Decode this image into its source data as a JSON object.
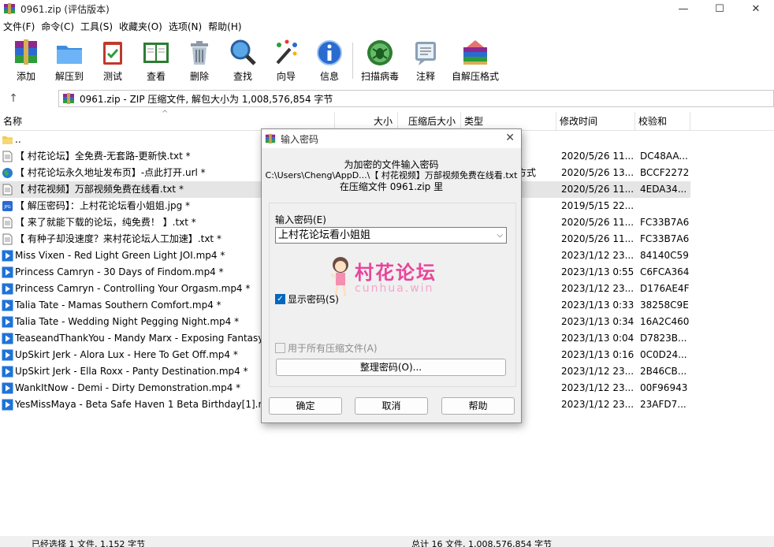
{
  "window": {
    "title": "0961.zip (评估版本)",
    "controls": [
      "—",
      "☐",
      "✕"
    ]
  },
  "menu": [
    "文件(F)",
    "命令(C)",
    "工具(S)",
    "收藏夹(O)",
    "选项(N)",
    "帮助(H)"
  ],
  "toolbar": {
    "add": "添加",
    "extract": "解压到",
    "test": "测试",
    "view": "查看",
    "delete": "删除",
    "find": "查找",
    "wizard": "向导",
    "info": "信息",
    "virus_scan": "扫描病毒",
    "comment": "注释",
    "sfx": "自解压格式"
  },
  "address": {
    "text": "0961.zip - ZIP 压缩文件, 解包大小为 1,008,576,854 字节"
  },
  "columns": {
    "name": "名称",
    "size": "大小",
    "packed": "压缩后大小",
    "type": "类型",
    "modified": "修改时间",
    "crc": "校验和"
  },
  "files": [
    {
      "name": "..",
      "type": "",
      "date": "",
      "crc": "",
      "icon": "folder-icon"
    },
    {
      "name": "【 村花论坛】全免费-无套路-更新快.txt *",
      "type": "",
      "date": "2020/5/26 11...",
      "crc": "DC48AA...",
      "icon": "text-file-icon"
    },
    {
      "name": "【 村花论坛永久地址发布页】-点此打开.url *",
      "type": "方式",
      "date": "2020/5/26 13...",
      "crc": "BCCF2272",
      "icon": "globe-icon"
    },
    {
      "name": "【 村花视频】万部视频免费在线看.txt *",
      "type": "",
      "date": "2020/5/26 11...",
      "crc": "4EDA34...",
      "icon": "text-file-icon"
    },
    {
      "name": "【 解压密码】：上村花论坛看小姐姐.jpg *",
      "type": "",
      "date": "2019/5/15 22...",
      "crc": "",
      "icon": "image-file-icon"
    },
    {
      "name": "【 来了就能下载的论坛，纯免费！ 】.txt *",
      "type": "",
      "date": "2020/5/26 11...",
      "crc": "FC33B7A6",
      "icon": "text-file-icon"
    },
    {
      "name": "【 有种子却没速度？来村花论坛人工加速】.txt *",
      "type": "",
      "date": "2020/5/26 11...",
      "crc": "FC33B7A6",
      "icon": "text-file-icon"
    },
    {
      "name": "Miss Vixen - Red Light Green Light JOI.mp4 *",
      "type": "",
      "date": "2023/1/12 23...",
      "crc": "84140C59",
      "icon": "video-file-icon"
    },
    {
      "name": "Princess Camryn - 30 Days of Findom.mp4 *",
      "type": "",
      "date": "2023/1/13 0:55",
      "crc": "C6FCA364",
      "icon": "video-file-icon"
    },
    {
      "name": "Princess Camryn - Controlling Your Orgasm.mp4 *",
      "type": "",
      "date": "2023/1/12 23...",
      "crc": "D176AE4F",
      "icon": "video-file-icon"
    },
    {
      "name": "Talia Tate - Mamas Southern Comfort.mp4 *",
      "type": "",
      "date": "2023/1/13 0:33",
      "crc": "38258C9E",
      "icon": "video-file-icon"
    },
    {
      "name": "Talia Tate - Wedding Night Pegging Night.mp4 *",
      "type": "",
      "date": "2023/1/13 0:34",
      "crc": "16A2C460",
      "icon": "video-file-icon"
    },
    {
      "name": "TeaseandThankYou - Mandy Marx - Exposing Fantasy",
      "type": "",
      "date": "2023/1/13 0:04",
      "crc": "D7823B...",
      "icon": "video-file-icon"
    },
    {
      "name": "UpSkirt Jerk - Alora Lux - Here To Get Off.mp4 *",
      "type": "",
      "date": "2023/1/13 0:16",
      "crc": "0C0D24...",
      "icon": "video-file-icon"
    },
    {
      "name": "UpSkirt Jerk - Ella Roxx - Panty Destination.mp4 *",
      "type": "",
      "date": "2023/1/12 23...",
      "crc": "2B46CB...",
      "icon": "video-file-icon"
    },
    {
      "name": "WankItNow - Demi - Dirty Demonstration.mp4 *",
      "type": "",
      "date": "2023/1/12 23...",
      "crc": "00F96943",
      "icon": "video-file-icon"
    },
    {
      "name": "YesMissMaya - Beta Safe Haven 1 Beta Birthday[1].mp",
      "type": "",
      "date": "2023/1/12 23...",
      "crc": "23AFD7...",
      "icon": "video-file-icon"
    }
  ],
  "status": {
    "left": "已经选择 1 文件, 1,152 字节",
    "right": "总计 16 文件, 1,008,576,854 字节"
  },
  "dialog": {
    "title": "输入密码",
    "close": "✕",
    "msg_line1": "为加密的文件输入密码",
    "msg_line2": "C:\\Users\\Cheng\\AppD...\\【 村花视频】万部视频免费在线看.txt",
    "msg_line3": "在压缩文件 0961.zip 里",
    "password_label": "输入密码(E)",
    "password_value": "上村花论坛看小姐姐",
    "watermark_cn": "村花论坛",
    "watermark_en": "cunhua.win",
    "show_password": "显示密码(S)",
    "show_password_checked": true,
    "use_for_all": "用于所有压缩文件(A)",
    "use_for_all_checked": false,
    "organize": "整理密码(O)...",
    "ok": "确定",
    "cancel": "取消",
    "help": "帮助"
  }
}
